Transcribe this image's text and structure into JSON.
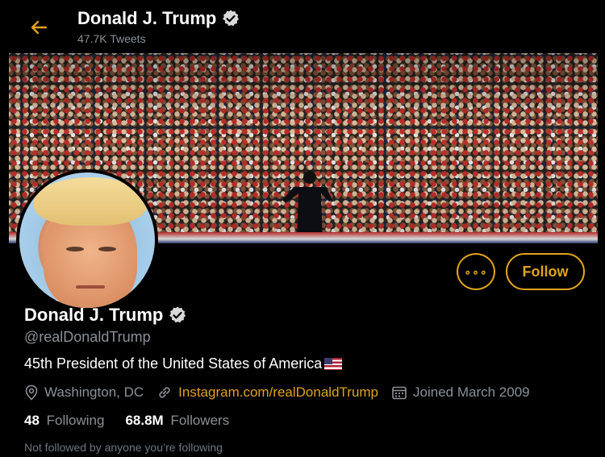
{
  "header": {
    "name": "Donald J. Trump",
    "tweet_count": "47.7K Tweets",
    "back_icon": "arrow-left-icon"
  },
  "profile": {
    "name": "Donald J. Trump",
    "handle": "@realDonaldTrump",
    "bio": "45th President of the United States of America",
    "bio_emoji": "us-flag",
    "location": "Washington, DC",
    "link": "Instagram.com/realDonaldTrump",
    "joined": "Joined March 2009",
    "following_count": "48",
    "following_label": "Following",
    "followers_count": "68.8M",
    "followers_label": "Followers",
    "not_followed": "Not followed by anyone you’re following"
  },
  "actions": {
    "more_label": "∘∘∘",
    "follow_label": "Follow"
  },
  "colors": {
    "accent": "#e0a31e",
    "background": "#000000",
    "muted": "#8b9096"
  }
}
